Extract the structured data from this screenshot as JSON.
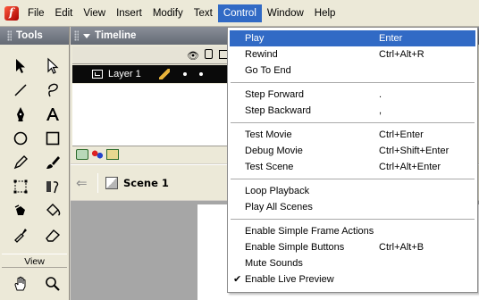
{
  "menubar": {
    "items": [
      "File",
      "Edit",
      "View",
      "Insert",
      "Modify",
      "Text",
      "Control",
      "Window",
      "Help"
    ],
    "active_index": 6
  },
  "tools_panel": {
    "title": "Tools",
    "view_label": "View"
  },
  "timeline": {
    "title": "Timeline",
    "layer_name": "Layer 1"
  },
  "scene": {
    "label": "Scene 1"
  },
  "control_menu": {
    "groups": [
      [
        {
          "label": "Play",
          "shortcut": "Enter",
          "highlighted": true
        },
        {
          "label": "Rewind",
          "shortcut": "Ctrl+Alt+R"
        },
        {
          "label": "Go To End",
          "shortcut": ""
        }
      ],
      [
        {
          "label": "Step Forward",
          "shortcut": "."
        },
        {
          "label": "Step Backward",
          "shortcut": ","
        }
      ],
      [
        {
          "label": "Test Movie",
          "shortcut": "Ctrl+Enter"
        },
        {
          "label": "Debug Movie",
          "shortcut": "Ctrl+Shift+Enter"
        },
        {
          "label": "Test Scene",
          "shortcut": "Ctrl+Alt+Enter"
        }
      ],
      [
        {
          "label": "Loop Playback",
          "shortcut": ""
        },
        {
          "label": "Play All Scenes",
          "shortcut": ""
        }
      ],
      [
        {
          "label": "Enable Simple Frame Actions",
          "shortcut": ""
        },
        {
          "label": "Enable Simple Buttons",
          "shortcut": "Ctrl+Alt+B"
        },
        {
          "label": "Mute Sounds",
          "shortcut": ""
        },
        {
          "label": "Enable Live Preview",
          "shortcut": "",
          "checked": true
        }
      ]
    ]
  },
  "colors": {
    "highlight": "#316ac5",
    "menubar_bg": "#ece9d8",
    "panel_title": "#646a74",
    "stage_bg": "#a6a6a6"
  }
}
